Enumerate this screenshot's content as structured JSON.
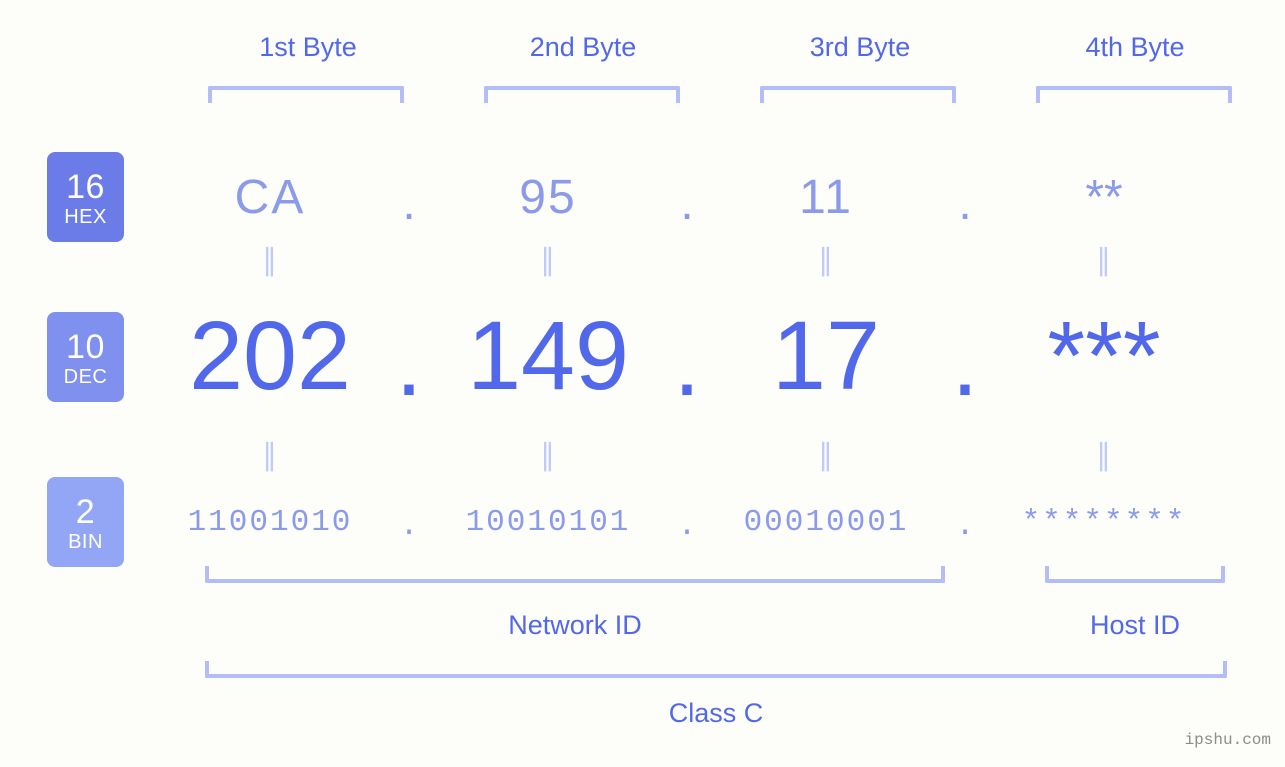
{
  "background_color": "#fdfdfa",
  "accent_color": "#5268ea",
  "muted_accent_color": "#8b9bea",
  "bracket_color": "#b3bdf7",
  "header": {
    "bytes": [
      {
        "label": "1st Byte"
      },
      {
        "label": "2nd Byte"
      },
      {
        "label": "3rd Byte"
      },
      {
        "label": "4th Byte"
      }
    ]
  },
  "rows": {
    "hex": {
      "badge_number": "16",
      "badge_name": "HEX",
      "badge_color": "#6b7ce8",
      "separator": ".",
      "values": [
        "CA",
        "95",
        "11",
        "**"
      ]
    },
    "dec": {
      "badge_number": "10",
      "badge_name": "DEC",
      "badge_color": "#7f90ee",
      "separator": ".",
      "values": [
        "202",
        "149",
        "17",
        "***"
      ]
    },
    "bin": {
      "badge_number": "2",
      "badge_name": "BIN",
      "badge_color": "#93a6f5",
      "separator": ".",
      "values": [
        "11001010",
        "10010101",
        "00010001",
        "********"
      ]
    }
  },
  "equals_marker": "=",
  "footer": {
    "network_id_label": "Network ID",
    "host_id_label": "Host ID",
    "class_label": "Class C"
  },
  "watermark": "ipshu.com"
}
